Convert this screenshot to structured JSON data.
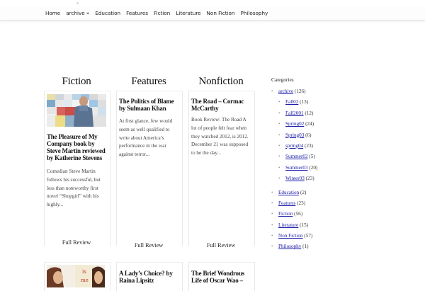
{
  "nav": {
    "items": [
      "Home",
      "archive »",
      "Education",
      "Features",
      "Fiction",
      "Literature",
      "Non Fiction",
      "Philosophy"
    ]
  },
  "columns": [
    {
      "title": "Fiction",
      "card": {
        "title": "The Pleasure of My Company book by Steve Martin reviewed by Katherine Stevens",
        "excerpt": "Comedian Steve Martin follows his successful, but less than noteworthy first novel “Shopgirl” with his highly...",
        "link": "Full Review"
      },
      "next_title": ""
    },
    {
      "title": "Features",
      "card": {
        "title": "The Politics of Blame by Sulmaan Khan",
        "excerpt": "At first glance, few would seem as well qualified to write about America’s performance in the war against terror...",
        "link": "Full Review"
      },
      "next_title": "A Lady’s Choice? by Raina Lipsitz"
    },
    {
      "title": "Nonfiction",
      "card": {
        "title": "The Road – Cormac McCarthy",
        "excerpt": "Book Review: The Road A lot of people felt fear when they watched 2012, is 2012. December 21 was supposed to be the day...",
        "link": "Full Review"
      },
      "next_title": "The Brief Wondrous Life of Oscar Wao –"
    }
  ],
  "sidebar": {
    "heading": "Categories",
    "items": [
      {
        "label": "archive",
        "count": "(126)",
        "children": [
          {
            "label": "Fall02",
            "count": "(13)"
          },
          {
            "label": "Fall2001",
            "count": "(12)"
          },
          {
            "label": "Spring02",
            "count": "(24)"
          },
          {
            "label": "Spring03",
            "count": "(6)"
          },
          {
            "label": "spring04",
            "count": "(23)"
          },
          {
            "label": "Summer02",
            "count": "(5)"
          },
          {
            "label": "Summer03",
            "count": "(20)"
          },
          {
            "label": "Winter03",
            "count": "(23)"
          }
        ]
      },
      {
        "label": "Education",
        "count": "(2)"
      },
      {
        "label": "Features",
        "count": "(23)"
      },
      {
        "label": "Fiction",
        "count": "(56)"
      },
      {
        "label": "Literature",
        "count": "(15)"
      },
      {
        "label": "Non Fiction",
        "count": "(57)"
      },
      {
        "label": "Philosophy",
        "count": "(1)"
      }
    ]
  },
  "colors": {
    "link": "#1a1aa6",
    "text": "#222222"
  }
}
